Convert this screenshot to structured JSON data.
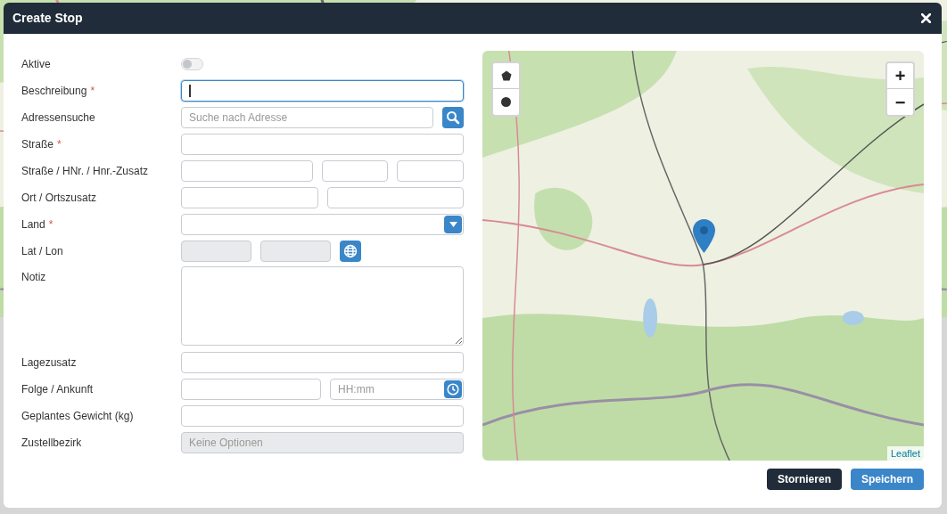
{
  "dialog": {
    "title": "Create Stop"
  },
  "fields": [
    {
      "kind": "toggle",
      "label": "Aktive",
      "on": false
    },
    {
      "kind": "text",
      "label": "Beschreibung",
      "required_mark": "*",
      "focused": true
    },
    {
      "kind": "search",
      "label": "Adressensuche",
      "placeholder": "Suche nach Adresse"
    },
    {
      "kind": "text",
      "label": "Straße",
      "required_mark": "*",
      "focused": false
    },
    {
      "kind": "split3",
      "label": "Straße / HNr. / Hnr.-Zusatz"
    },
    {
      "kind": "split2",
      "label": "Ort / Ortszusatz"
    },
    {
      "kind": "select",
      "label": "Land",
      "required_mark": "*"
    },
    {
      "kind": "latlon",
      "label": "Lat / Lon",
      "disabled": true
    },
    {
      "kind": "textarea",
      "label": "Notiz"
    },
    {
      "kind": "text",
      "label": "Lagezusatz",
      "focused": false
    },
    {
      "kind": "time",
      "label": "Folge / Ankunft",
      "placeholder": "HH:mm"
    },
    {
      "kind": "text",
      "label": "Geplantes Gewicht (kg)",
      "focused": false
    },
    {
      "kind": "select_disabled",
      "label": "Zustellbezirk",
      "placeholder": "Keine Optionen",
      "disabled": true
    }
  ],
  "map": {
    "zoom_in": "+",
    "zoom_out": "−",
    "attribution": "Leaflet"
  },
  "buttons": [
    {
      "kind": "cancel",
      "label": "Stornieren"
    },
    {
      "kind": "primary",
      "label": "Speichern"
    }
  ]
}
